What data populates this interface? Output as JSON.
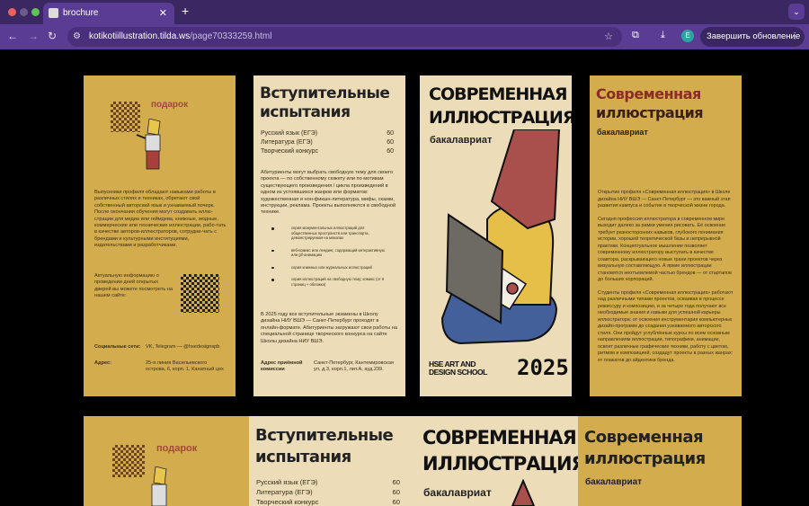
{
  "browser": {
    "tab_title": "brochure",
    "url_host": "kotikotiillustration.tilda.ws",
    "url_path": "/page70333259.html",
    "avatar_letter": "E",
    "update_button": "Завершить обновление"
  },
  "card1": {
    "gift_label": "подарок",
    "graduates_text": "Выпускники профиля обладают навыками работы в различных стилях и техниках, обретают свой собственный авторский язык и узнаваемый почерк. После окончания обучения могут создавать иллю-страции для медиа или геймдева, книжные, модные, коммерческие или технические иллюстрации, рабо-тать в качестве авторов-иллюстраторов, сотрудни-чать с брендами и культурными институциями, издательствами и разработчиками.",
    "open_days_text": "Актуальную информацию о проведении дней открытых дверей вы можете посмотреть на нашем сайте:",
    "social_label": "Социальные сети:",
    "social_value": "VK, Telegram — @hsedesignspb",
    "address_label": "Адрес:",
    "address_value": "25-я линия Васильевского острова, 6, корп. 1, Канатный цех"
  },
  "card2": {
    "title_line1": "Вступительные",
    "title_line2": "испытания",
    "exams": [
      {
        "name": "Русский язык (ЕГЭ)",
        "score": "60"
      },
      {
        "name": "Литература  (ЕГЭ)",
        "score": "60"
      },
      {
        "name": "Творческий конкурс",
        "score": "60"
      }
    ],
    "intro": "Абитуриенты могут выбрать свободную тему для своего проекта — по собственному сюжету или по мотивам существующего произведения / цикла произведений в одном из устоявшихся жанров или форматов: художественная и нон-фикшн-литература, мифы, сказки, инструкции, реклама. Проекты выполняются в свободной технике.",
    "bullets": [
      "серия монументальных иллюстраций для общественных пространств или транспорта, демонстрируемая на мокапах",
      "веб-комикс или лендинг, содержащий интерактивную или gif-анимацию",
      "серия книжных или журнальных иллюстраций",
      "серия иллюстраций на свободную тему; комикс (от 6 страниц + обложка)"
    ],
    "online_text": "В 2025 году все вступительные экзамены в Школу дизайна НИУ ВШЭ — Санкт-Петербург проходят в онлайн-формате. Абитуриенты загружают свои работы на специальной странице творческого конкурса на сайте Школы дизайна НИУ ВШЭ.",
    "address_label": "Адрес приёмной комиссии",
    "address_value": "Санкт-Петербург, Кантемировская ул, д.3, корп.1, лит.А, ауд.239."
  },
  "card3": {
    "title_line1": "СОВРЕМЕННАЯ",
    "title_line2": "ИЛЛЮСТРАЦИЯ",
    "subtitle": "бакалавриат",
    "school_line1": "HSE ART AND",
    "school_line2": "DESIGN SCHOOL",
    "year": "2025"
  },
  "card4": {
    "title_line1": "Современная",
    "title_line2": "иллюстрация",
    "subtitle": "бакалавриат",
    "p1": "Открытие профиля «Современная иллюстрация» в Школе дизайна НИУ ВШЭ — Санкт-Петербург — это важный этап развития кампуса и событие в творческой жизни города.",
    "p2": "Сегодня профессия иллюстратора в современном мире выходит далеко за рамки умения рисовать. Её освоение требует разносторонних навыков, глубокого понимания истории, хорошей теоретической базы и непрерывной практики. Концептуальное мышление позволяет современному иллюстратору выступать в качестве соавтора, раскрывающего новые грани проектов через визуальную составляющую. А яркие иллюстрации становятся неотъемлемой частью брендов — от стартапов до больших корпораций.",
    "p3": "Студенты профиля «Современная иллюстрация» работают над различными типами проектов, осваивая в процессе режиссуру и композицию, и за четыре года получают все необходимые знания и навыки для успешной карьеры иллюстратора: от освоения инструментария компьютерных дизайн-программ до создания узнаваемого авторского стиля. Они пройдут углублённые курсы по всем основным направлениям иллюстрации, типографики, анимации, освоят различные графические техники, работу с цветом, ритмом и композицией, создадут проекты в разных жанрах: от плакатов до айдентики бренда."
  }
}
